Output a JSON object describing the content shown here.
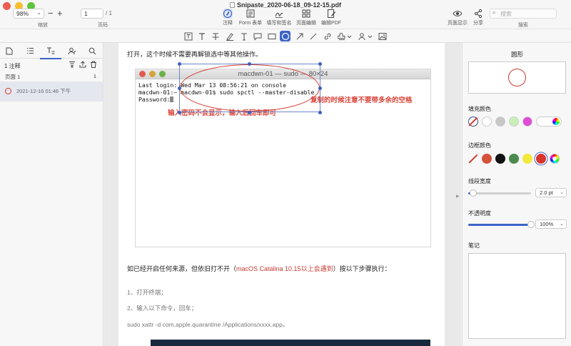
{
  "window": {
    "title": "Snipaste_2020-06-18_09-12-15.pdf"
  },
  "toolbar": {
    "zoom_value": "98%",
    "zoom_label": "缩放",
    "zoom_out": "−",
    "zoom_in": "+",
    "page_value": "1",
    "page_total": "/ 1",
    "page_label": "页码",
    "tools": [
      {
        "label": "注释"
      },
      {
        "label": "Form 表单"
      },
      {
        "label": "填写和签名"
      },
      {
        "label": "页面编辑"
      },
      {
        "label": "编辑PDF"
      }
    ],
    "view_label": "页面显示",
    "share_label": "分享",
    "search_label": "搜索",
    "search_placeholder": "搜索"
  },
  "left_panel": {
    "annotation_count": "1 注释",
    "page_row": {
      "label": "页面 1",
      "count": "1"
    },
    "item": {
      "timestamp": "2021-12-16 01:46 下午"
    }
  },
  "document": {
    "line1": "打开，这个时候不需要再解锁选中等其他操作。",
    "terminal": {
      "title": "macdwn-01 — sudo — 80×24",
      "lines": [
        "Last login: Wed Mar 13 08:56:21 on console",
        "macdwn-01:~ macdwn-01$ sudo spctl --master-disable",
        "Password:"
      ],
      "hint_left": "输入密码不会显示，输入后回车即可",
      "hint_right": "复制的时候注意不要带多余的空格"
    },
    "para2_pre": "如已经开启任何来源，但依旧打不开（",
    "para2_red": "macOS Catalina 10.15以上会遇到",
    "para2_post": "）按以下步骤执行：",
    "step1": "1、打开终端；",
    "step2": "2、输入以下命令，回车；",
    "command": "sudo xattr -d com.apple.quarantine /Applications/xxxx.app。"
  },
  "right_panel": {
    "title": "圆形",
    "fill_label": "填充颜色",
    "fill_colors": [
      "none",
      "#ffffff",
      "#c7c7c7",
      "#c8f0b8",
      "#e04bd8"
    ],
    "border_label": "边框颜色",
    "border_colors": [
      "none",
      "#d4523a",
      "#111111",
      "#4a8a4c",
      "#f1ea3a",
      "#d8352b"
    ],
    "line_width_label": "线段宽度",
    "line_width_value": "2.0 pt",
    "line_width_fraction": 0.08,
    "opacity_label": "不透明度",
    "opacity_value": "100%",
    "opacity_fraction": 1.0,
    "notes_label": "笔记"
  }
}
